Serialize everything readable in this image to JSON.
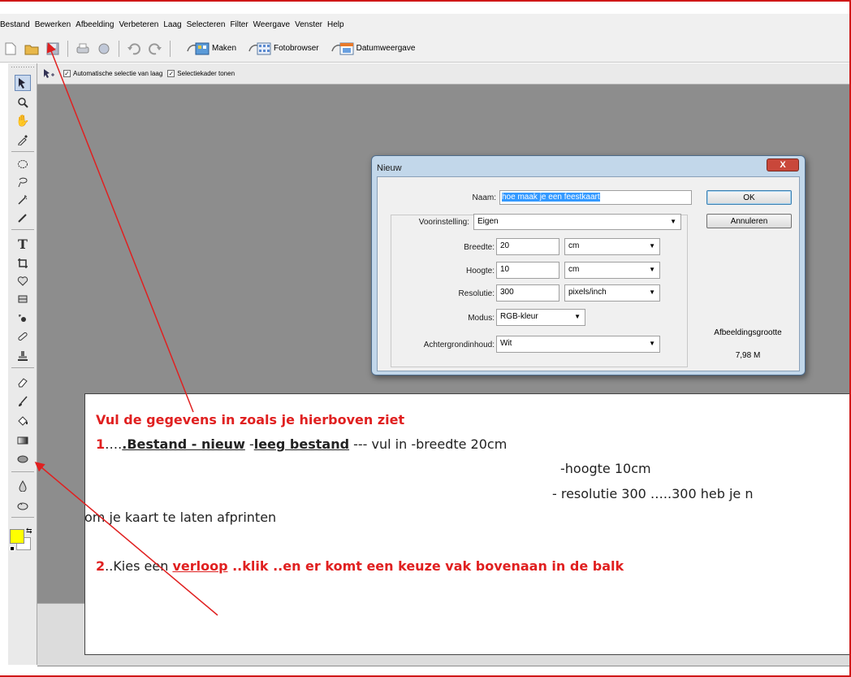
{
  "menu": [
    "Bestand",
    "Bewerken",
    "Afbeelding",
    "Verbeteren",
    "Laag",
    "Selecteren",
    "Filter",
    "Weergave",
    "Venster",
    "Help"
  ],
  "toolbar": {
    "create_label": "Maken",
    "photobrowser_label": "Fotobrowser",
    "dateview_label": "Datumweergave"
  },
  "options": {
    "auto_select_label": "Automatische selectie van laag",
    "show_bounds_label": "Selectiekader tonen",
    "check_mark": "✓"
  },
  "dialog": {
    "title": "Nieuw",
    "close_label": "X",
    "name_label": "Naam:",
    "name_value": "hoe maak je  een  feestkaart",
    "preset_label": "Voorinstelling:",
    "preset_value": "Eigen",
    "width_label": "Breedte:",
    "width_value": "20",
    "width_unit": "cm",
    "height_label": "Hoogte:",
    "height_value": "10",
    "height_unit": "cm",
    "resolution_label": "Resolutie:",
    "resolution_value": "300",
    "resolution_unit": "pixels/inch",
    "mode_label": "Modus:",
    "mode_value": "RGB-kleur",
    "background_label": "Achtergrondinhoud:",
    "background_value": "Wit",
    "ok_label": "OK",
    "cancel_label": "Annuleren",
    "image_size_label": "Afbeeldingsgrootte",
    "image_size_value": "7,98 M"
  },
  "note": {
    "heading": "Vul de gegevens in zoals je hierboven ziet",
    "step1_num": "1",
    "step1_dots": "….",
    "step1_a": ".Bestand - ",
    "step1_b": "nieuw",
    "step1_dash": " -",
    "step1_c": "leeg bestand",
    "step1_rest": "   --- vul  in -breedte 20cm",
    "step1_height": "-hoogte   10cm",
    "step1_res": "- resolutie 300   …..300 heb je n",
    "step1_print": "om je kaart te laten afprinten",
    "step2_num": "2",
    "step2_pre": "..Kies een ",
    "step2_link": "verloop",
    "step2_rest": " ..klik ..en er komt een  keuze vak bovenaan  in de balk"
  },
  "colors": {
    "frame": "#d01818",
    "accent_red": "#e02020",
    "foreground_swatch": "#ffff00",
    "selection_blue": "#3399ff"
  }
}
